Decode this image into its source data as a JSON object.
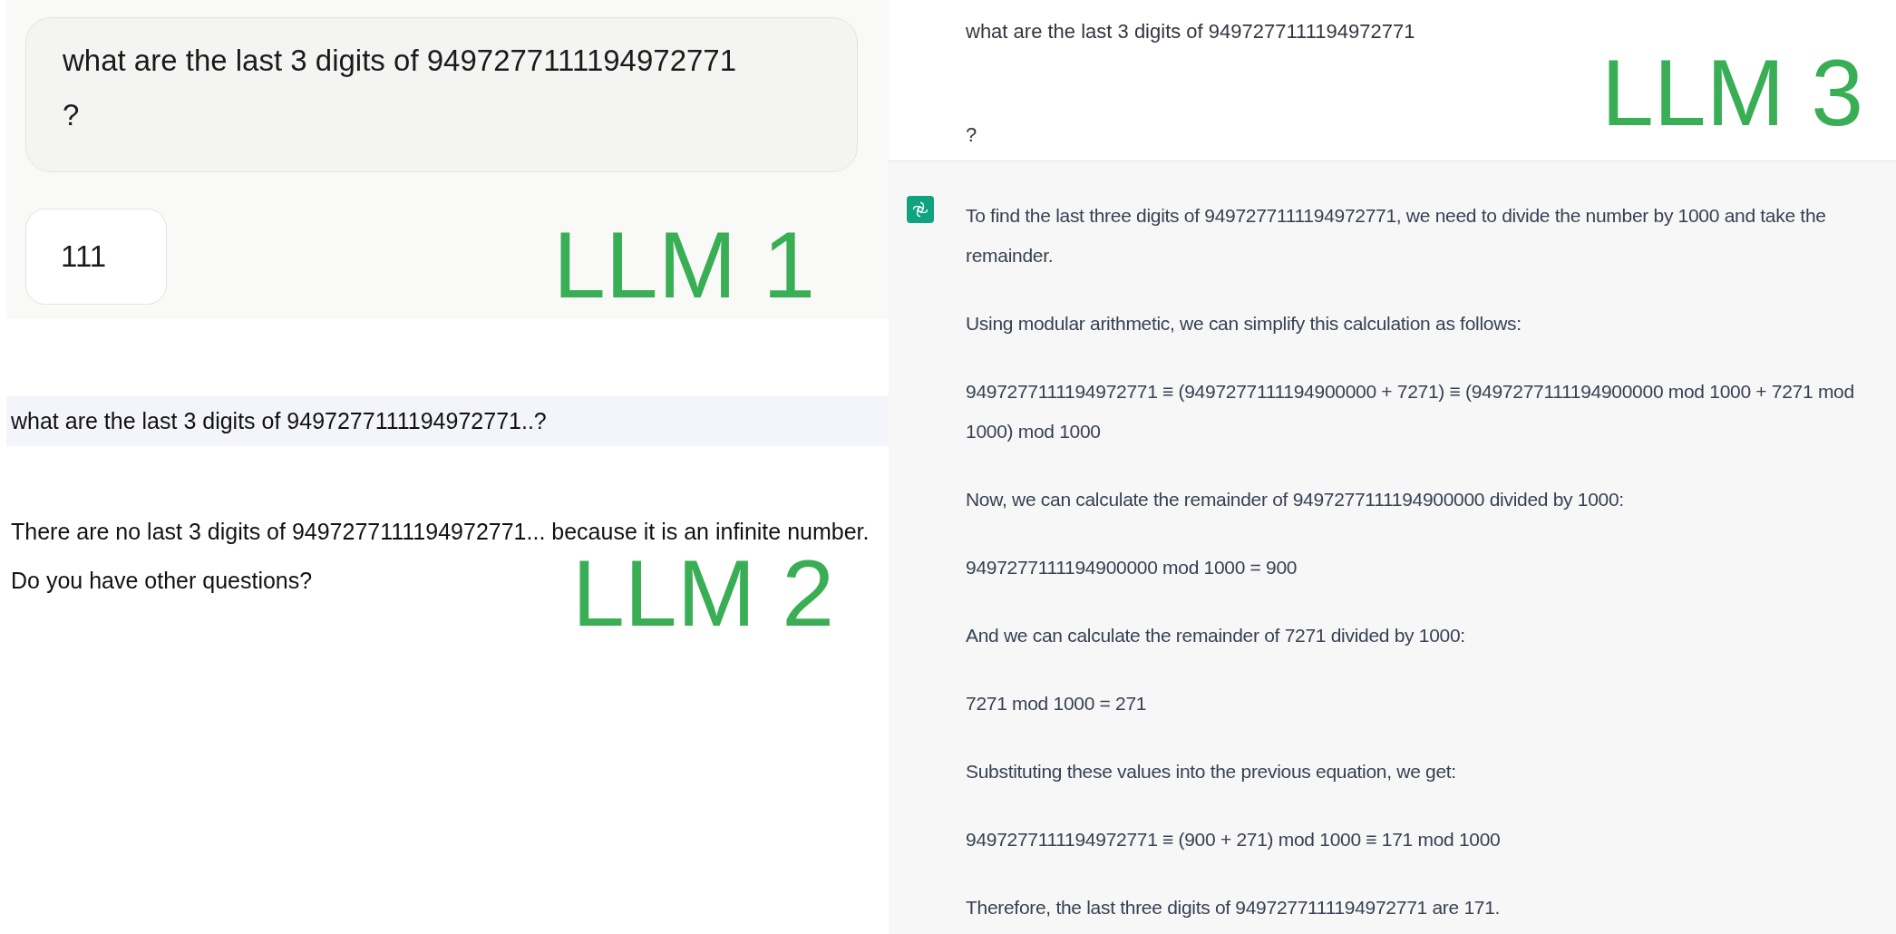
{
  "panels": [
    {
      "kind": "bubbles",
      "label": "LLM 1",
      "question": [
        "what are the last 3 digits of 9497277111194972771",
        "?"
      ],
      "answer": [
        "111"
      ]
    },
    {
      "kind": "plain",
      "label": "LLM 2",
      "question": [
        "what are the last 3 digits of 9497277111194972771..?"
      ],
      "answer": [
        "There are no last 3 digits of 9497277111194972771... because it is an infinite number.",
        "Do you have other questions?"
      ]
    },
    {
      "kind": "assistant",
      "label": "LLM 3",
      "question": [
        "what are the last 3 digits of 9497277111194972771",
        "?"
      ],
      "answer": [
        "To find the last three digits of 9497277111194972771, we need to divide the number by 1000 and take the remainder.",
        "Using modular arithmetic, we can simplify this calculation as follows:",
        "9497277111194972771 ≡ (9497277111194900000 + 7271) ≡ (9497277111194900000 mod 1000 + 7271 mod 1000) mod 1000",
        "Now, we can calculate the remainder of 9497277111194900000 divided by 1000:",
        "9497277111194900000 mod 1000 = 900",
        "And we can calculate the remainder of 7271 divided by 1000:",
        "7271 mod 1000 = 271",
        "Substituting these values into the previous equation, we get:",
        "9497277111194972771 ≡ (900 + 271) mod 1000 ≡ 171 mod 1000",
        "Therefore, the last three digits of 9497277111194972771 are 171."
      ]
    }
  ]
}
